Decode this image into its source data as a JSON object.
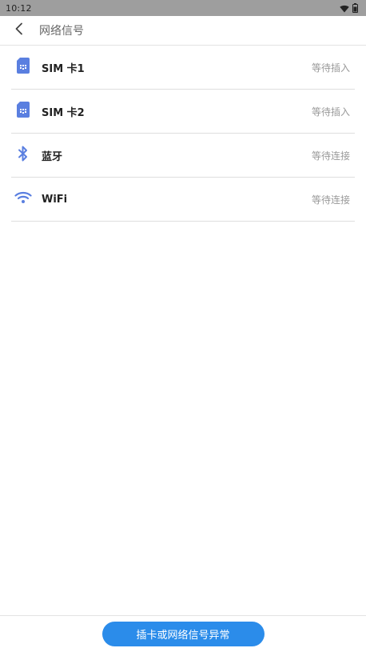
{
  "status_bar": {
    "time": "10:12",
    "icons": [
      "wifi-icon",
      "battery-icon"
    ]
  },
  "header": {
    "title": "网络信号",
    "back_icon": "chevron-left-icon"
  },
  "items": [
    {
      "label": "SIM 卡1",
      "status": "等待插入",
      "icon": "sim-card-icon"
    },
    {
      "label": "SIM 卡2",
      "status": "等待插入",
      "icon": "sim-card-icon"
    },
    {
      "label": "蓝牙",
      "status": "等待连接",
      "icon": "bluetooth-icon"
    },
    {
      "label": "WiFi",
      "status": "等待连接",
      "icon": "wifi-icon"
    }
  ],
  "footer": {
    "button_label": "插卡或网络信号异常"
  },
  "colors": {
    "accent": "#2b8cea",
    "icon": "#5a7fe0",
    "status_bar": "#9e9e9e"
  }
}
